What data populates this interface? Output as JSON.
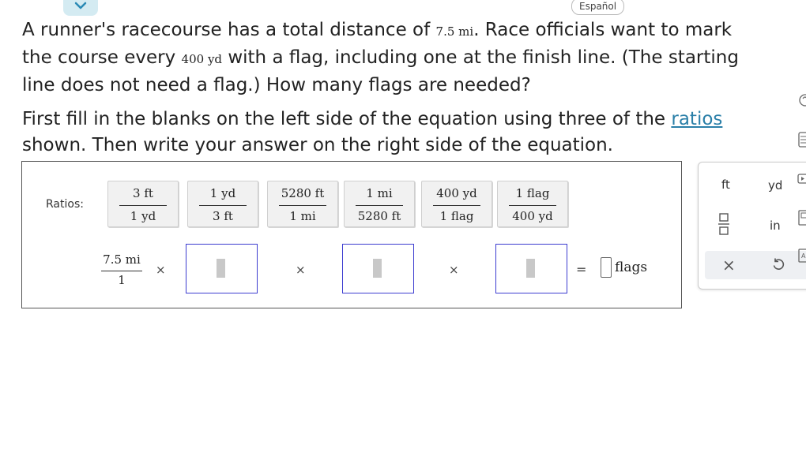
{
  "header": {
    "collapse_icon": "chevron-down-icon",
    "language_button": "Español"
  },
  "problem": {
    "p1": "A runner's racecourse has a total distance of ",
    "distance": "7.5 mi",
    "p2": ". Race officials want to mark the course every ",
    "interval": "400 yd",
    "p3": " with a flag, including one at the finish line. (The starting line does not need a flag.) How many flags are needed?"
  },
  "instructions": {
    "p1": "First fill in the blanks on the left side of the equation using three of the ",
    "link": "ratios",
    "p2": " shown. Then write your answer on the right side of the equation."
  },
  "work": {
    "ratios_label": "Ratios:",
    "ratios": [
      {
        "num": "3 ft",
        "den": "1 yd"
      },
      {
        "num": "1 yd",
        "den": "3 ft"
      },
      {
        "num": "5280 ft",
        "den": "1 mi"
      },
      {
        "num": "1 mi",
        "den": "5280 ft"
      },
      {
        "num": "400 yd",
        "den": "1 flag"
      },
      {
        "num": "1 flag",
        "den": "400 yd"
      }
    ],
    "given": {
      "num": "7.5 mi",
      "den": "1"
    },
    "times": "×",
    "equals": "=",
    "answer_value": "",
    "answer_unit": "flags"
  },
  "keypad": {
    "ft": "ft",
    "yd": "yd",
    "in": "in",
    "fraction_icon": "fraction-icon",
    "clear": "×",
    "undo_icon": "undo-icon"
  },
  "colors": {
    "accent": "#3d3dd0",
    "link": "#2a7fa8",
    "collapse_bg": "#d4ebf2"
  }
}
